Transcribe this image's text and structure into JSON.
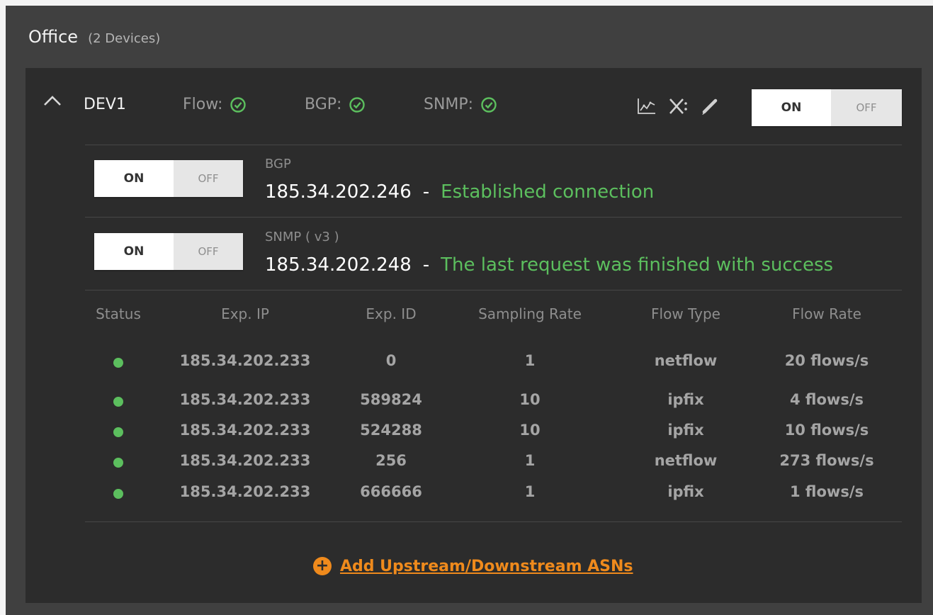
{
  "group": {
    "name": "Office",
    "count": "(2 Devices)"
  },
  "device": {
    "name": "DEV1",
    "statuses": [
      {
        "label": "Flow:",
        "state": "ok"
      },
      {
        "label": "BGP:",
        "state": "ok"
      },
      {
        "label": "SNMP:",
        "state": "ok"
      }
    ],
    "icons": [
      "chart-icon",
      "disconnect-icon",
      "edit-icon"
    ],
    "toggle": {
      "on": "ON",
      "off": "OFF",
      "selected": "ON"
    }
  },
  "protocols": [
    {
      "label": "BGP",
      "ip": "185.34.202.246",
      "dash": "-",
      "status": "Established connection",
      "toggle": {
        "on": "ON",
        "off": "OFF",
        "selected": "ON"
      }
    },
    {
      "label": "SNMP ( v3 )",
      "ip": "185.34.202.248",
      "dash": "-",
      "status": "The last request was finished with success",
      "toggle": {
        "on": "ON",
        "off": "OFF",
        "selected": "ON"
      }
    }
  ],
  "table": {
    "headers": [
      "Status",
      "Exp. IP",
      "Exp. ID",
      "Sampling Rate",
      "Flow Type",
      "Flow Rate"
    ],
    "rows": [
      {
        "status": "ok",
        "ip": "185.34.202.233",
        "id": "0",
        "rate": "1",
        "type": "netflow",
        "flow": "20 flows/s"
      },
      {
        "status": "ok",
        "ip": "185.34.202.233",
        "id": "589824",
        "rate": "10",
        "type": "ipfix",
        "flow": "4 flows/s"
      },
      {
        "status": "ok",
        "ip": "185.34.202.233",
        "id": "524288",
        "rate": "10",
        "type": "ipfix",
        "flow": "10 flows/s"
      },
      {
        "status": "ok",
        "ip": "185.34.202.233",
        "id": "256",
        "rate": "1",
        "type": "netflow",
        "flow": "273 flows/s"
      },
      {
        "status": "ok",
        "ip": "185.34.202.233",
        "id": "666666",
        "rate": "1",
        "type": "ipfix",
        "flow": "1 flows/s"
      }
    ]
  },
  "add_link": {
    "label": "Add Upstream/Downstream ASNs",
    "icon": "plus-circle-icon"
  },
  "colors": {
    "accent": "#ef8a1c",
    "success": "#5cbf5e",
    "panel": "#2c2c2c",
    "outer": "#404040"
  }
}
